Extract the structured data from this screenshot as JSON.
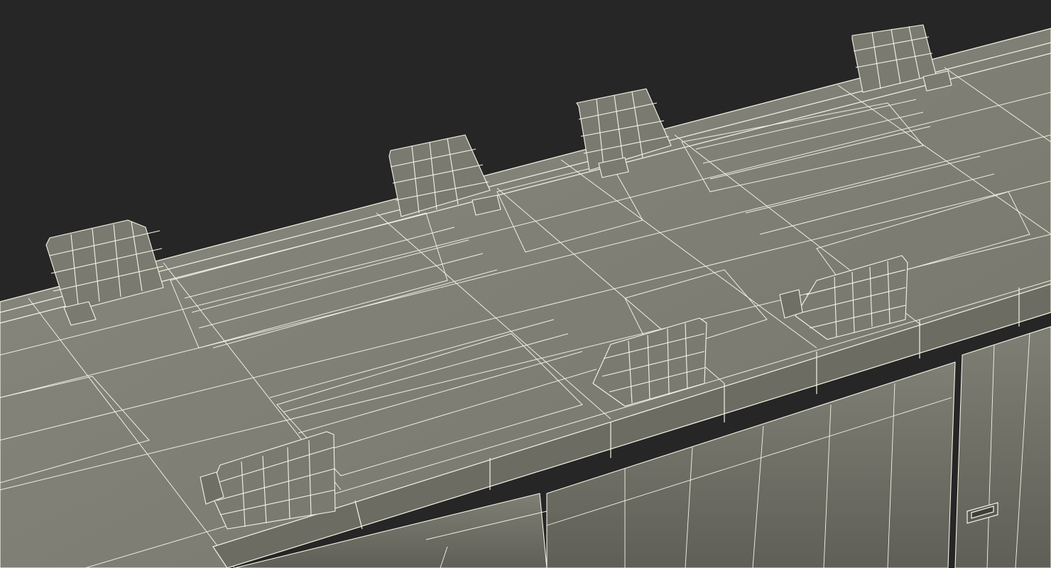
{
  "scene": {
    "background_color": "#262626",
    "surface_color": "#7d7d73",
    "surface_dark_color": "#6c6c63",
    "surface_light_color": "#8a8a80",
    "wire_color": "#f4f4e6"
  },
  "objects": {
    "top_seats_count": 4,
    "front_seats_count": 3,
    "front_panel_sections_count": 3,
    "handle_count": 1
  }
}
